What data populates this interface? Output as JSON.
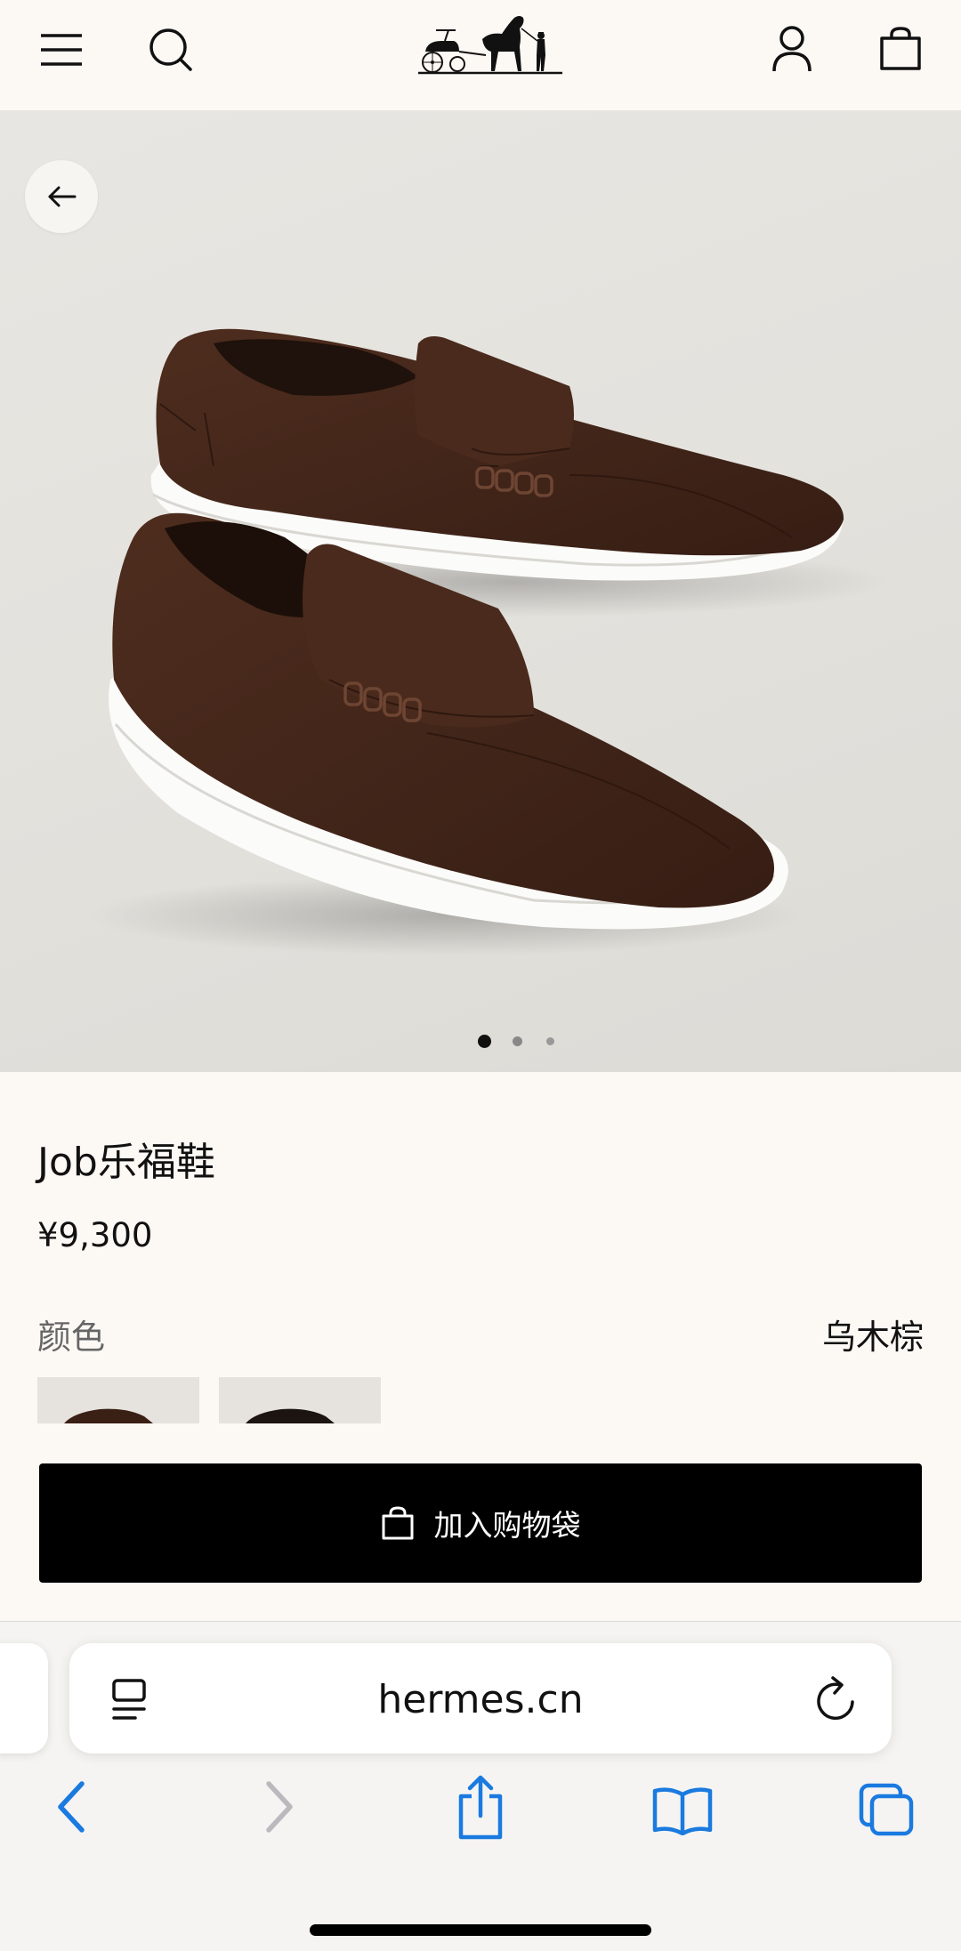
{
  "header": {
    "menu_icon": "menu-icon",
    "search_icon": "search-icon",
    "logo": "hermes-logo",
    "account_icon": "user-icon",
    "bag_icon": "shopping-bag-icon"
  },
  "gallery": {
    "back_icon": "arrow-left-icon",
    "page_count": 3,
    "active_index": 0
  },
  "product": {
    "title": "Job乐福鞋",
    "price": "¥9,300",
    "color_label": "颜色",
    "color_value": "乌木棕"
  },
  "cta": {
    "add_to_bag": "加入购物袋"
  },
  "browser": {
    "url": "hermes.cn",
    "reader_icon": "reader-icon",
    "reload_icon": "reload-icon",
    "toolbar": [
      "back-icon",
      "forward-icon",
      "share-icon",
      "bookmarks-icon",
      "tabs-icon"
    ]
  },
  "colors": {
    "page_bg": "#fcf9f5",
    "cta_bg": "#000000",
    "safari_blue": "#1a7ae0",
    "shoe_brown": "#4a2a1c"
  }
}
